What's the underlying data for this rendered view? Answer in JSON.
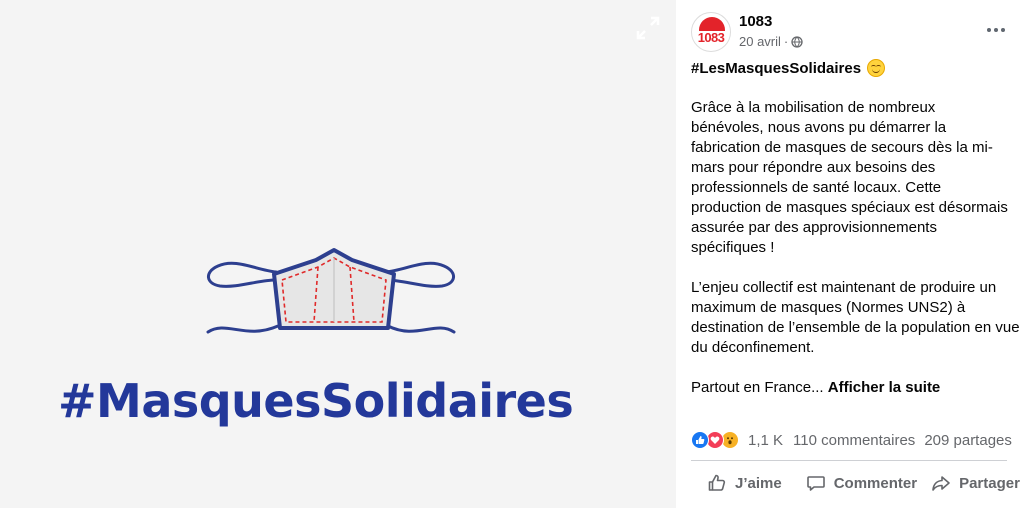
{
  "media": {
    "caption": "#MasquesSolidaires",
    "icons": {
      "expand": "expand-arrows-icon",
      "mask": "face-mask-illustration"
    }
  },
  "post": {
    "avatar_text": "1083",
    "page_name": "1083",
    "date": "20 avril",
    "separator": "·",
    "icons": {
      "privacy": "globe-icon",
      "more": "more-options-icon",
      "emoji": "smiling-face-icon"
    },
    "hashtag": "#LesMasquesSolidaires",
    "paragraphs": [
      "Grâce à la mobilisation de nombreux bénévoles, nous avons pu démarrer la fabrication de masques de secours dès la mi-mars pour répondre aux besoins des professionnels de santé locaux. Cette production de masques spéciaux est désormais assurée par des approvisionnements spécifiques !",
      "L’enjeu collectif est maintenant de produire un maximum de masques (Normes UNS2) à destination de l’ensemble de la population en vue du déconfinement."
    ],
    "truncated_text": "Partout en France...",
    "see_more_label": "Afficher la suite"
  },
  "engagement": {
    "reaction_icons": [
      "like-reaction-icon",
      "love-reaction-icon",
      "wow-reaction-icon"
    ],
    "reactions_count": "1,1 K",
    "comments": "110 commentaires",
    "shares": "209 partages"
  },
  "actions": {
    "like_label": "J’aime",
    "comment_label": "Commenter",
    "share_label": "Partager"
  },
  "colors": {
    "brand_red": "#e3232a",
    "caption_blue": "#23389a",
    "mask_red_stitch": "#e02a2a",
    "facebook_blue": "#1877f2",
    "secondary_text": "#65676b"
  }
}
